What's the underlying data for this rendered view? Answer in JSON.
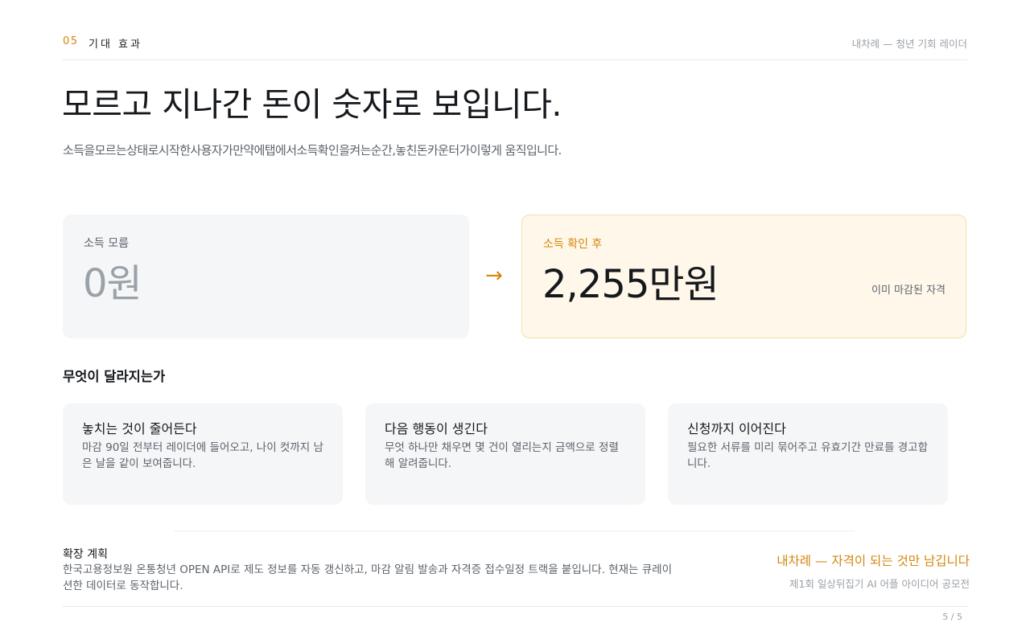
{
  "header": {
    "section_number": "05",
    "section_title": "기대 효과",
    "deck_title": "내차례 — 청년 기회 레이더"
  },
  "headline": "모르고 지나간 돈이 숫자로 보입니다.",
  "subheadline": "소득을모르는상태로시작한사용자가만약에탭에서소득확인을켜는순간,놓친돈카운터가이렇게 움직입니다.",
  "comparison": {
    "before": {
      "label": "소득 모름",
      "value": "0원"
    },
    "arrow": "→",
    "after": {
      "label": "소득 확인 후",
      "value": "2,255만원",
      "note": "이미 마감된 자격"
    }
  },
  "changes": {
    "title": "무엇이 달라지는가",
    "items": [
      {
        "title": "놓치는 것이 줄어든다",
        "desc": "마감 90일 전부터 레이더에 들어오고, 나이 컷까지 남은 날을 같이 보여줍니다."
      },
      {
        "title": "다음 행동이 생긴다",
        "desc": "무엇 하나만 채우면 몇 건이 열리는지 금액으로 정렬해 알려줍니다."
      },
      {
        "title": "신청까지 이어진다",
        "desc": "필요한 서류를 미리 묶어주고 유효기간 만료를 경고합니다."
      }
    ]
  },
  "footer": {
    "plan_title": "확장 계획",
    "plan_text": "한국고용정보원 온통청년 OPEN API로 제도 정보를 자동 갱신하고, 마감 알림 발송과 자격증 접수일정 트랙을 붙입니다. 현재는 큐레이션한 데이터로 동작합니다.",
    "tagline": "내차례 — 자격이 되는 것만 남깁니다",
    "contest": "제1회 일상뒤집기 AI 어플 아이디어 공모전",
    "page": "5 / 5"
  },
  "colors": {
    "accent": "#d4860b",
    "text": "#15181c",
    "muted": "#5c636b",
    "card_bg": "#f5f6f8",
    "highlight_bg": "#fff8ea"
  }
}
